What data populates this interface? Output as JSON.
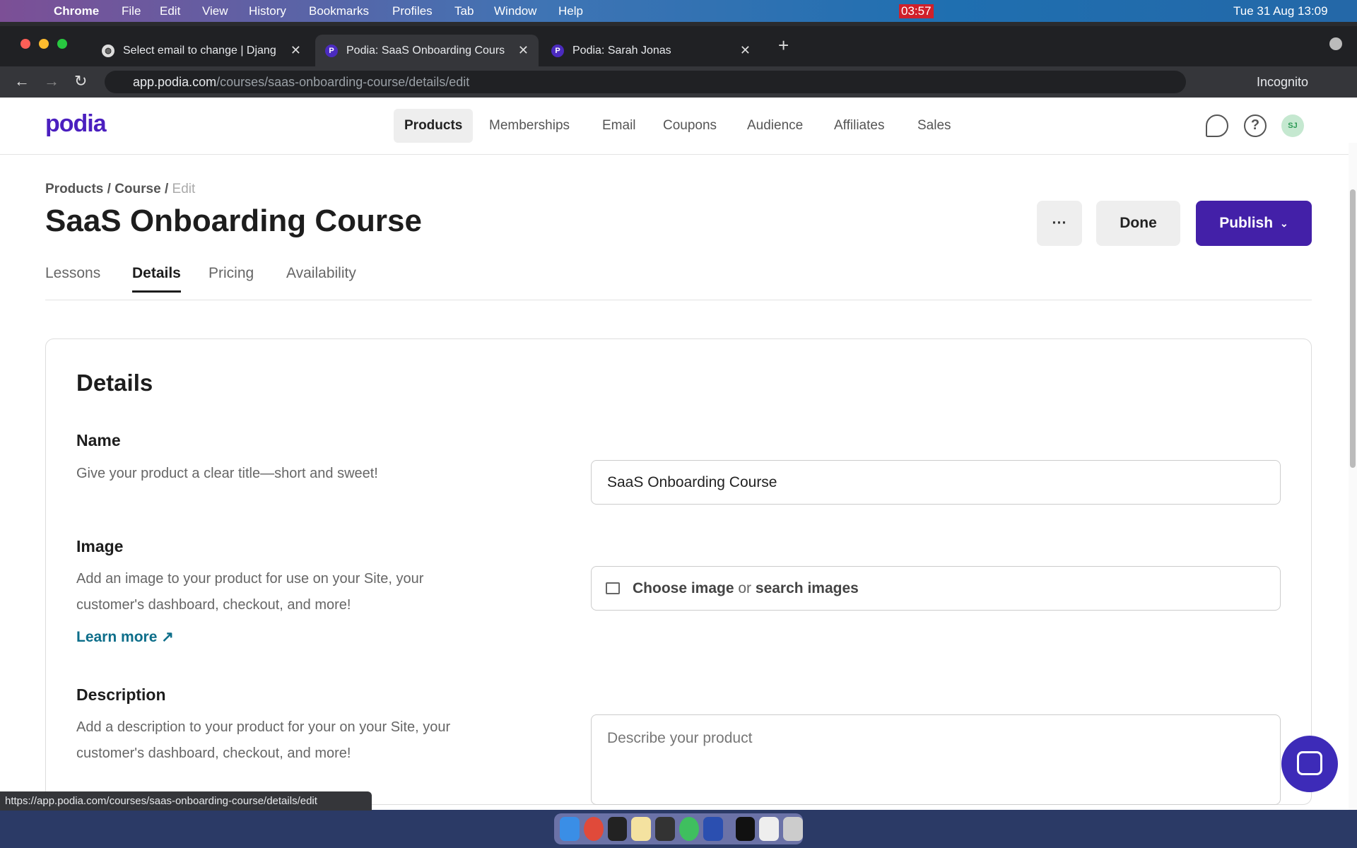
{
  "menubar": {
    "items": [
      "Chrome",
      "File",
      "Edit",
      "View",
      "History",
      "Bookmarks",
      "Profiles",
      "Tab",
      "Window",
      "Help"
    ],
    "timer": "03:57",
    "datetime": "Tue 31 Aug  13:09"
  },
  "browser": {
    "tabs": [
      {
        "title": "Select email to change | Djang"
      },
      {
        "title": "Podia: SaaS Onboarding Cours"
      },
      {
        "title": "Podia: Sarah Jonas"
      }
    ],
    "url_host": "app.podia.com",
    "url_path": "/courses/saas-onboarding-course/details/edit",
    "profile": "Incognito",
    "status_url": "https://app.podia.com/courses/saas-onboarding-course/details/edit"
  },
  "header": {
    "logo": "podia",
    "nav": [
      "Products",
      "Memberships",
      "Email",
      "Coupons",
      "Audience",
      "Affiliates",
      "Sales"
    ],
    "avatar": "SJ"
  },
  "breadcrumb": {
    "a": "Products",
    "b": "Course",
    "c": "Edit",
    "sep": " / "
  },
  "page": {
    "title": "SaaS Onboarding Course",
    "more": "···",
    "done": "Done",
    "publish": "Publish"
  },
  "tabs": [
    "Lessons",
    "Details",
    "Pricing",
    "Availability"
  ],
  "details": {
    "heading": "Details",
    "name": {
      "label": "Name",
      "help": "Give your product a clear title—short and sweet!",
      "value": "SaaS Onboarding Course"
    },
    "image": {
      "label": "Image",
      "help": "Add an image to your product for use on your Site, your customer's dashboard, checkout, and more!",
      "learn_more": "Learn more ↗",
      "choose": "Choose image",
      "or": " or ",
      "search": "search images"
    },
    "description": {
      "label": "Description",
      "help": "Add a description to your product for your on your Site, your customer's dashboard, checkout, and more!",
      "placeholder": "Describe your product"
    }
  },
  "colors": {
    "brand": "#4b1fbf",
    "publish": "#4320a8",
    "link": "#0d6e8a"
  }
}
